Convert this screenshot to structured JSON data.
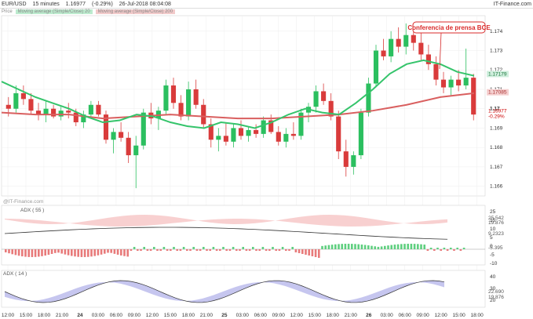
{
  "header": {
    "symbol": "EUR/USD",
    "interval": "15 minutes",
    "last": "1.16977",
    "change": "(-0.29%)",
    "datetime": "26-Jul-2018 08:04:08",
    "brand": "IT-Finance.com"
  },
  "legend": {
    "price_label": "Price",
    "ma_fast_label": "Moving average (Simple/Close) 20",
    "ma_slow_label": "Moving average (Simple/Close) 200",
    "ma_fast_color": "#35c46b",
    "ma_slow_color": "#d95f5f"
  },
  "annotation": {
    "text": "Conferencia de prensa BCE",
    "color": "#d92b2b"
  },
  "price_axis": {
    "ticks": [
      "1.174",
      "1.173",
      "1.172",
      "1.171",
      "1.17",
      "1.169",
      "1.168",
      "1.167",
      "1.166"
    ],
    "labels": {
      "ma_fast": "1.17179",
      "ma_slow": "1.17085",
      "last_bold": "1.17",
      "last": "1.16977",
      "last_change": "-0.29%"
    }
  },
  "adx_panel": {
    "watermark": "@IT-Finance.com",
    "title": "ADX ( 55 )",
    "left_ticks": [
      "25",
      "15",
      "10",
      "5",
      "0",
      "-5",
      "-10"
    ],
    "right_labels": [
      "25.542",
      "19.876",
      "9.2323",
      "-5.395"
    ]
  },
  "osc_panel": {
    "title": "ADX ( 14 )",
    "left_ticks": [
      "40",
      "30",
      "20"
    ],
    "right_labels": [
      "22.690",
      "19.876"
    ]
  },
  "time_axis": {
    "labels": [
      "12:00",
      "15:00",
      "18:00",
      "21:00",
      "24",
      "03:00",
      "06:00",
      "09:00",
      "12:00",
      "15:00",
      "18:00",
      "21:00",
      "25",
      "03:00",
      "06:00",
      "09:00",
      "12:00",
      "15:00",
      "18:00",
      "21:00",
      "26",
      "03:00",
      "06:00",
      "09:00",
      "12:00",
      "15:00",
      "18:00"
    ],
    "bold": [
      "24",
      "25",
      "26"
    ]
  },
  "chart_data": {
    "type": "candlestick",
    "title": "",
    "xlabel": "",
    "ylabel": "",
    "ylim": [
      1.1655,
      1.1748
    ],
    "ma_fast_points": [
      [
        0,
        1.1714
      ],
      [
        20,
        1.171
      ],
      [
        40,
        1.1706
      ],
      [
        60,
        1.1703
      ],
      [
        80,
        1.17
      ],
      [
        100,
        1.1696
      ],
      [
        120,
        1.1693
      ],
      [
        140,
        1.1694
      ],
      [
        160,
        1.1697
      ],
      [
        180,
        1.1696
      ],
      [
        200,
        1.1693
      ],
      [
        220,
        1.1691
      ],
      [
        240,
        1.169
      ],
      [
        260,
        1.1693
      ],
      [
        280,
        1.1692
      ],
      [
        300,
        1.169
      ],
      [
        320,
        1.1693
      ],
      [
        340,
        1.1697
      ],
      [
        360,
        1.17
      ],
      [
        380,
        1.1698
      ],
      [
        400,
        1.1697
      ],
      [
        420,
        1.1703
      ],
      [
        440,
        1.171
      ],
      [
        460,
        1.1718
      ],
      [
        480,
        1.1723
      ],
      [
        500,
        1.1725
      ],
      [
        520,
        1.1723
      ],
      [
        540,
        1.1719
      ],
      [
        560,
        1.1717
      ]
    ],
    "ma_slow_points": [
      [
        0,
        1.1698
      ],
      [
        40,
        1.1697
      ],
      [
        80,
        1.1697
      ],
      [
        120,
        1.1695
      ],
      [
        160,
        1.1696
      ],
      [
        200,
        1.1697
      ],
      [
        240,
        1.1696
      ],
      [
        280,
        1.1695
      ],
      [
        320,
        1.1695
      ],
      [
        360,
        1.1696
      ],
      [
        400,
        1.1697
      ],
      [
        440,
        1.1699
      ],
      [
        480,
        1.1702
      ],
      [
        520,
        1.1706
      ],
      [
        560,
        1.1708
      ]
    ],
    "candles": [
      [
        1.1702,
        1.1706,
        1.1696,
        1.17
      ],
      [
        1.17,
        1.1712,
        1.1698,
        1.1708
      ],
      [
        1.1708,
        1.1712,
        1.1702,
        1.1705
      ],
      [
        1.1705,
        1.1708,
        1.1697,
        1.1699
      ],
      [
        1.1699,
        1.1703,
        1.1694,
        1.1697
      ],
      [
        1.1697,
        1.1704,
        1.1693,
        1.17
      ],
      [
        1.17,
        1.1702,
        1.1695,
        1.1696
      ],
      [
        1.1696,
        1.1701,
        1.1694,
        1.1699
      ],
      [
        1.1699,
        1.1703,
        1.1695,
        1.1698
      ],
      [
        1.1698,
        1.17,
        1.1691,
        1.1693
      ],
      [
        1.1693,
        1.1699,
        1.169,
        1.1697
      ],
      [
        1.1697,
        1.1704,
        1.1695,
        1.1702
      ],
      [
        1.1702,
        1.1704,
        1.1696,
        1.1697
      ],
      [
        1.1697,
        1.1699,
        1.1682,
        1.1684
      ],
      [
        1.1684,
        1.169,
        1.1677,
        1.1688
      ],
      [
        1.1688,
        1.1693,
        1.1683,
        1.1685
      ],
      [
        1.1685,
        1.1688,
        1.1672,
        1.1676
      ],
      [
        1.1676,
        1.1686,
        1.1659,
        1.1681
      ],
      [
        1.1681,
        1.17,
        1.1679,
        1.1698
      ],
      [
        1.1698,
        1.1703,
        1.1692,
        1.1695
      ],
      [
        1.1695,
        1.1701,
        1.1689,
        1.1699
      ],
      [
        1.1699,
        1.1715,
        1.1697,
        1.1712
      ],
      [
        1.1712,
        1.1716,
        1.17,
        1.1703
      ],
      [
        1.1703,
        1.1707,
        1.1694,
        1.1696
      ],
      [
        1.1696,
        1.1714,
        1.1694,
        1.171
      ],
      [
        1.171,
        1.1715,
        1.17,
        1.1702
      ],
      [
        1.1702,
        1.1705,
        1.169,
        1.1692
      ],
      [
        1.1692,
        1.1695,
        1.168,
        1.1684
      ],
      [
        1.1684,
        1.169,
        1.1678,
        1.1686
      ],
      [
        1.1686,
        1.1693,
        1.1681,
        1.1683
      ],
      [
        1.1683,
        1.1692,
        1.168,
        1.169
      ],
      [
        1.169,
        1.1694,
        1.1684,
        1.1686
      ],
      [
        1.1686,
        1.1691,
        1.1683,
        1.1689
      ],
      [
        1.1689,
        1.1692,
        1.1685,
        1.1687
      ],
      [
        1.1687,
        1.1696,
        1.1685,
        1.1694
      ],
      [
        1.1694,
        1.1697,
        1.1687,
        1.1688
      ],
      [
        1.1688,
        1.1691,
        1.1681,
        1.1683
      ],
      [
        1.1683,
        1.169,
        1.168,
        1.1687
      ],
      [
        1.1687,
        1.1693,
        1.1684,
        1.1686
      ],
      [
        1.1686,
        1.17,
        1.1684,
        1.1698
      ],
      [
        1.1698,
        1.1703,
        1.1693,
        1.1701
      ],
      [
        1.1701,
        1.1712,
        1.1698,
        1.1709
      ],
      [
        1.1709,
        1.1713,
        1.1702,
        1.1704
      ],
      [
        1.1704,
        1.1708,
        1.1694,
        1.1696
      ],
      [
        1.1696,
        1.1699,
        1.1674,
        1.1678
      ],
      [
        1.1678,
        1.1684,
        1.1665,
        1.167
      ],
      [
        1.167,
        1.1678,
        1.1666,
        1.1676
      ],
      [
        1.1676,
        1.17,
        1.1674,
        1.1698
      ],
      [
        1.1698,
        1.1716,
        1.1696,
        1.1713
      ],
      [
        1.1713,
        1.1733,
        1.1711,
        1.173
      ],
      [
        1.173,
        1.1736,
        1.1725,
        1.1727
      ],
      [
        1.1727,
        1.174,
        1.1724,
        1.1736
      ],
      [
        1.1736,
        1.1742,
        1.1729,
        1.1732
      ],
      [
        1.1732,
        1.1744,
        1.1728,
        1.1738
      ],
      [
        1.1738,
        1.1743,
        1.173,
        1.1734
      ],
      [
        1.1734,
        1.174,
        1.1725,
        1.1728
      ],
      [
        1.1728,
        1.1733,
        1.172,
        1.1723
      ],
      [
        1.1723,
        1.1727,
        1.1712,
        1.1715
      ],
      [
        1.1715,
        1.1719,
        1.1708,
        1.1711
      ],
      [
        1.1711,
        1.1717,
        1.1707,
        1.1715
      ],
      [
        1.1715,
        1.172,
        1.1709,
        1.1712
      ],
      [
        1.1712,
        1.1731,
        1.171,
        1.1716
      ],
      [
        1.1716,
        1.1718,
        1.1694,
        1.1697
      ]
    ]
  }
}
